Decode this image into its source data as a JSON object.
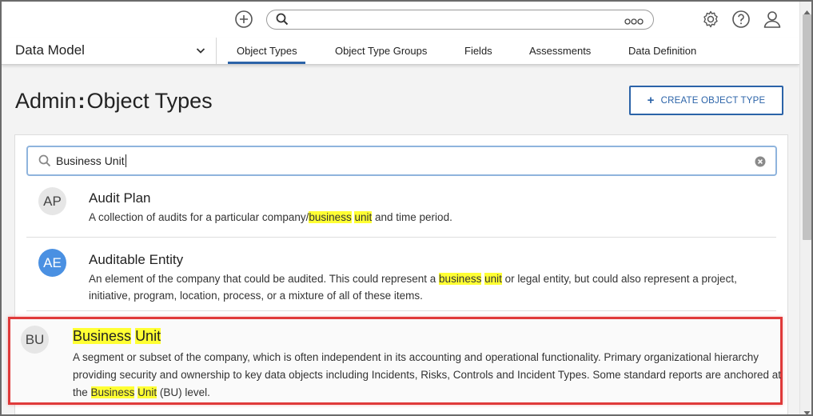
{
  "topbar": {
    "add_icon": "plus-circle-icon",
    "search_placeholder": "",
    "more_icon": "ellipsis-icon",
    "settings_icon": "gear-icon",
    "help_icon": "help-circle-icon",
    "user_icon": "user-icon"
  },
  "nav": {
    "module": "Data Model",
    "tabs": [
      {
        "label": "Object Types",
        "active": true
      },
      {
        "label": "Object Type Groups",
        "active": false
      },
      {
        "label": "Fields",
        "active": false
      },
      {
        "label": "Assessments",
        "active": false
      },
      {
        "label": "Data Definition",
        "active": false
      }
    ]
  },
  "header": {
    "title_prefix": "Admin",
    "title_sep": ":",
    "title": "Object Types",
    "create_button": "CREATE OBJECT TYPE"
  },
  "search": {
    "value": "Business Unit"
  },
  "results": [
    {
      "initials": "AP",
      "title": "Audit Plan",
      "desc": {
        "a": "A collection of audits for a particular company/",
        "h1": "business",
        "h2": "unit",
        "b": "and time period."
      }
    },
    {
      "initials": "AE",
      "title": "Auditable Entity",
      "desc": {
        "a": "An element of the company that could be audited. This could represent a",
        "h1": "business",
        "h2": "unit",
        "b": "or legal entity, but could also represent a project, initiative, program, location, process, or a mixture of all of these items."
      }
    },
    {
      "initials": "BU",
      "title": {
        "h1": "Business",
        "h2": "Unit"
      },
      "desc": {
        "a": "A segment or subset of the company, which is often independent in its accounting and operational functionality. Primary organizational hierarchy providing security and ownership to key data objects including Incidents, Risks, Controls and Incident Types. Some standard reports are anchored at the",
        "h1": "Business",
        "h2": "Unit",
        "b": "(BU) level."
      }
    }
  ],
  "colors": {
    "accent": "#2b63a8",
    "highlight": "#ffff33",
    "selection_border": "#e03a3a",
    "avatar_blue": "#4a90e2"
  }
}
